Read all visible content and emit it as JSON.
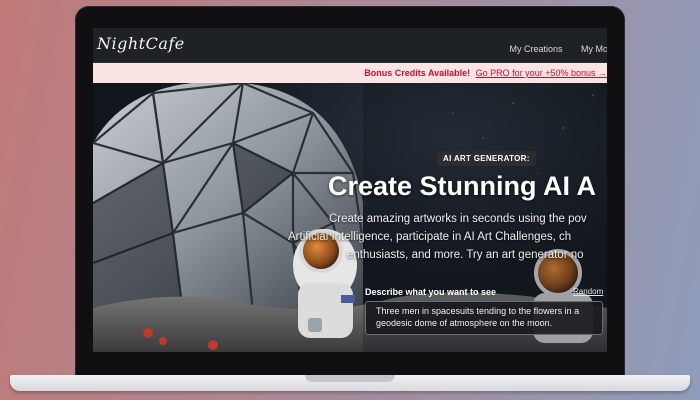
{
  "site": {
    "logo": "NightCafe",
    "nav": [
      "My Creations",
      "My Mod"
    ]
  },
  "promo": {
    "bold_text": "Bonus Credits Available!",
    "link_text": "Go PRO for your +50% bonus →"
  },
  "hero": {
    "badge": "AI ART GENERATOR:",
    "headline": "Create Stunning AI A",
    "subtext_lines": [
      "Create amazing artworks in seconds using the pov",
      "Artificial Intelligence, participate in AI Art Challenges, ch",
      "enthusiasts, and more. Try an art generator no"
    ],
    "prompt_label": "Describe what you want to see",
    "random_label": "Random",
    "prompt_value": "Three men in spacesuits tending to the flowers in a geodesic dome of atmosphere on the moon."
  },
  "colors": {
    "accent": "#c8102e",
    "promo_bg": "#fce4e4",
    "header_bg": "#1f2225"
  },
  "icons": [
    "laptop-frame",
    "astronaut-illustration",
    "geodesic-dome-illustration"
  ]
}
